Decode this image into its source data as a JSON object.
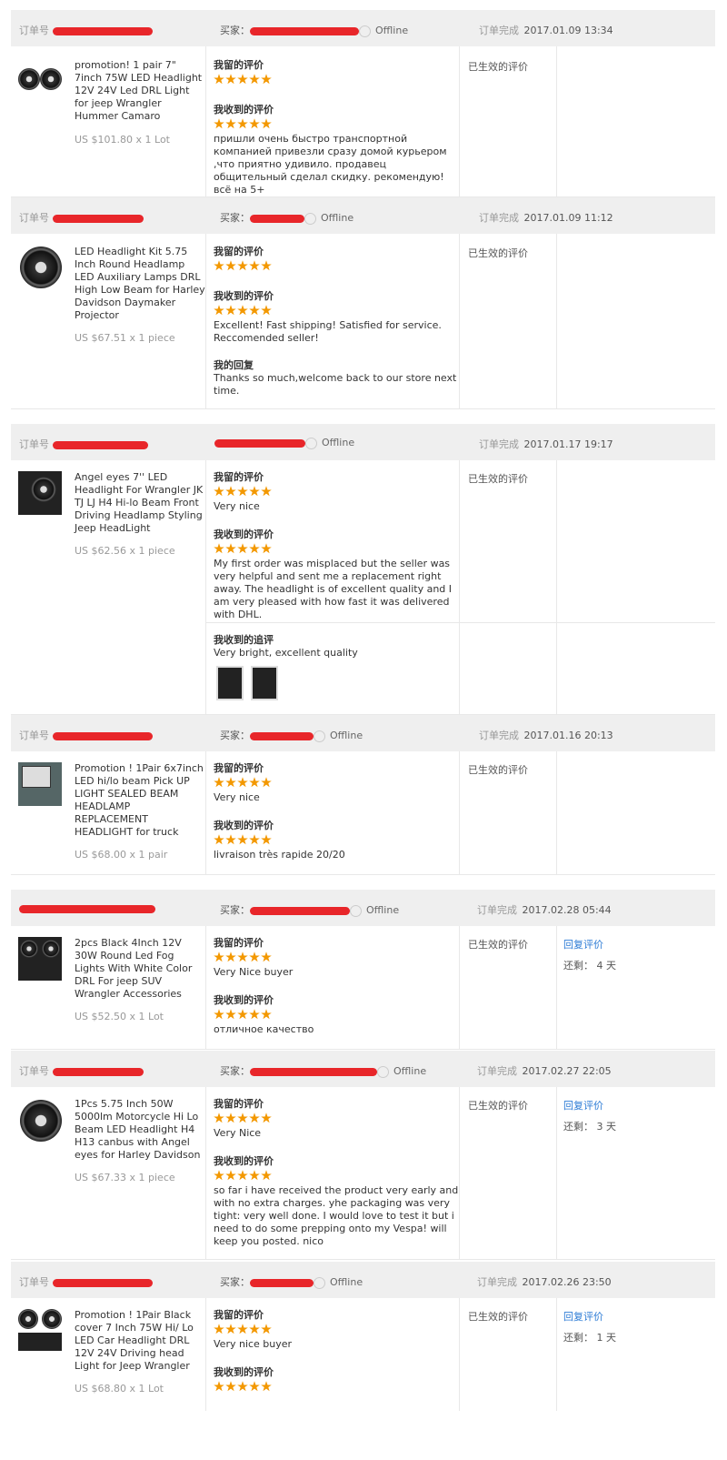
{
  "labels": {
    "order_no": "订单号",
    "buyer": "买家：",
    "offline": "Offline",
    "order_done": "订单完成",
    "my_review": "我留的评价",
    "received_review": "我收到的评价",
    "my_reply": "我的回复",
    "followup": "我收到的追评",
    "effective": "已生效的评价",
    "reply_link": "回复评价",
    "remaining": "还剩："
  },
  "orders": [
    {
      "date": "2017.01.09 13:34",
      "product": "promotion! 1 pair 7\" 7inch 75W LED Headlight 12V 24V Led DRL Light for jeep Wrangler Hummer Camaro",
      "price": "US $101.80 x 1 Lot",
      "my_review": "",
      "received_review": "пришли очень быстро транспортной компанией привезли сразу домой курьером ,что приятно удивило. продавец общительный сделал скидку. рекомендую! всё на 5+"
    },
    {
      "date": "2017.01.09 11:12",
      "product": "LED Headlight Kit 5.75 Inch Round Headlamp LED Auxiliary Lamps DRL High Low Beam for Harley Davidson Daymaker Projector",
      "price": "US $67.51 x 1 piece",
      "my_review": "",
      "received_review": "Excellent! Fast shipping! Satisfied for service. Reccomended seller!",
      "my_reply": "Thanks so much,welcome back to our store next time."
    },
    {
      "date": "2017.01.17 19:17",
      "product": "Angel eyes 7'' LED Headlight For Wrangler JK TJ LJ H4 Hi-lo Beam Front Driving Headlamp Styling Jeep HeadLight",
      "price": "US $62.56 x 1 piece",
      "my_review": "Very nice",
      "received_review": "My first order was misplaced but the seller was very helpful and sent me a replacement right away. The headlight is of excellent quality and I am very pleased with how fast it was delivered with DHL.",
      "followup": "Very bright, excellent quality"
    },
    {
      "date": "2017.01.16 20:13",
      "product": "Promotion ! 1Pair 6x7inch LED hi/lo beam Pick UP LIGHT SEALED BEAM HEADLAMP REPLACEMENT HEADLIGHT for truck",
      "price": "US $68.00 x 1 pair",
      "my_review": "Very nice",
      "received_review": "livraison très rapide 20/20"
    },
    {
      "date": "2017.02.28 05:44",
      "product": "2pcs Black 4Inch 12V 30W Round Led Fog Lights With White Color DRL For jeep SUV Wrangler Accessories",
      "price": "US $52.50 x 1 Lot",
      "my_review": "Very Nice buyer",
      "received_review": "отличное качество",
      "remaining": "4 天"
    },
    {
      "date": "2017.02.27 22:05",
      "product": "1Pcs 5.75 Inch 50W 5000lm Motorcycle Hi Lo Beam LED Headlight H4 H13 canbus with Angel eyes for Harley Davidson",
      "price": "US $67.33 x 1 piece",
      "my_review": "Very Nice",
      "received_review": "so far i have received the product very early and with no extra charges. yhe packaging was very tight: very well done. I would love to test it but i need to do some prepping onto my Vespa! will keep you posted. nico",
      "remaining": "3 天"
    },
    {
      "date": "2017.02.26 23:50",
      "product": "Promotion ! 1Pair Black cover 7 Inch 75W Hi/ Lo LED Car Headlight DRL 12V 24V Driving head Light for Jeep Wrangler",
      "price": "US $68.80 x 1 Lot",
      "my_review": "Very nice buyer",
      "received_review": "",
      "remaining": "1 天"
    }
  ],
  "colors": {
    "star": "#f39800",
    "link": "#2c7bd5",
    "mask": "#e8262a",
    "header_bg": "#efefef"
  }
}
